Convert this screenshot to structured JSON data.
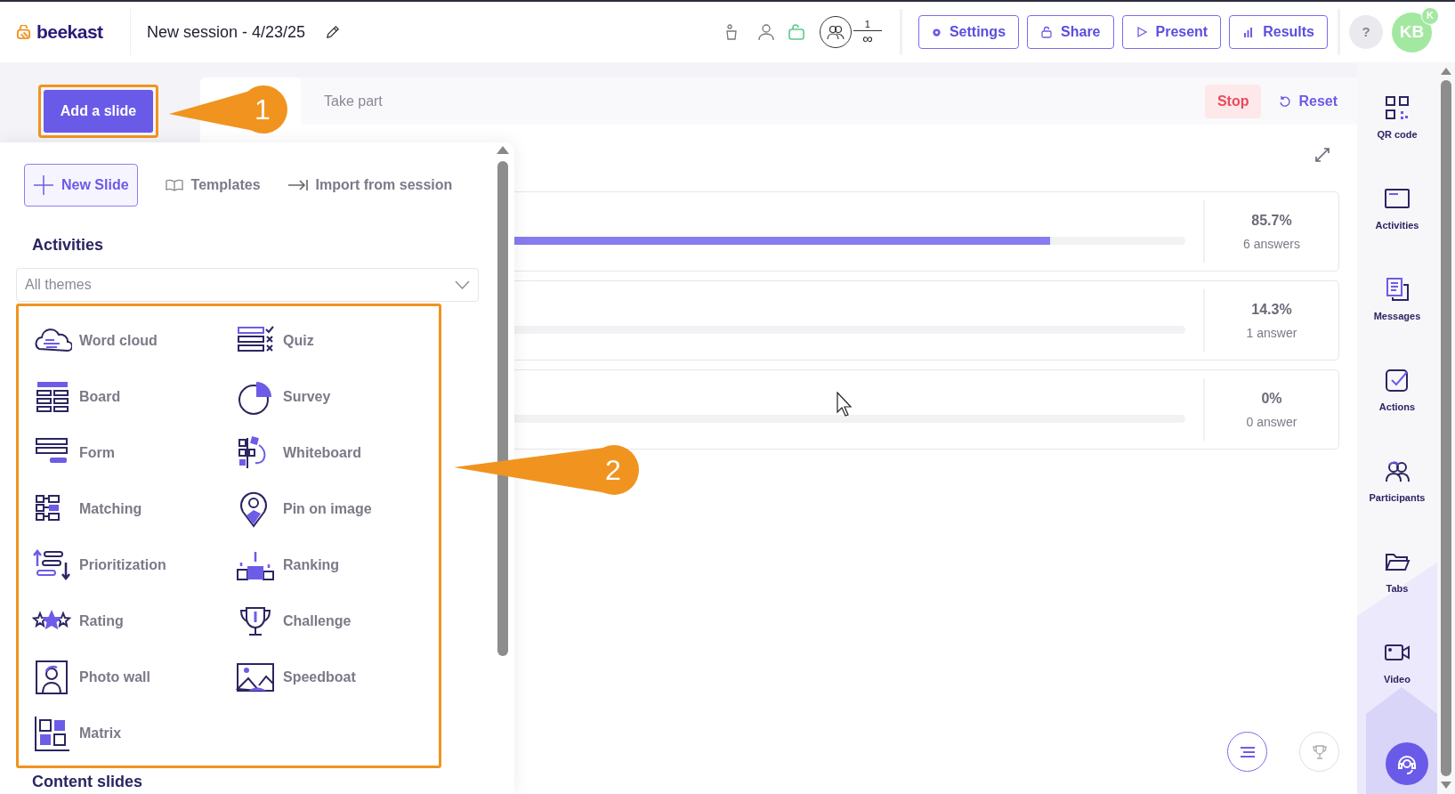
{
  "header": {
    "logo": "beekast",
    "title": "New session - 4/23/25",
    "participants": {
      "count": "1",
      "limit": "∞"
    },
    "buttons": [
      {
        "label": "Settings",
        "kind": "settings"
      },
      {
        "label": "Share",
        "kind": "share"
      },
      {
        "label": "Present",
        "kind": "present"
      },
      {
        "label": "Results",
        "kind": "results"
      }
    ],
    "help": "?",
    "avatar": {
      "initials": "KB",
      "badge": "K"
    }
  },
  "toolbar": {
    "add_button": "Add a slide",
    "tab": "Take part",
    "stop": "Stop",
    "reset": "Reset"
  },
  "callouts": [
    {
      "number": "1"
    },
    {
      "number": "2"
    }
  ],
  "results": [
    {
      "percent": "85.7%",
      "answers": "6 answers",
      "level": 0.857
    },
    {
      "percent": "14.3%",
      "answers": "1 answer"
    },
    {
      "percent": "0%",
      "answers": "0 answer"
    }
  ],
  "panel": {
    "tabs": [
      {
        "label": "New Slide",
        "selected": true
      },
      {
        "label": "Templates",
        "selected": false
      },
      {
        "label": "Import from session",
        "selected": false
      }
    ],
    "heading": "Activities",
    "theme_select": {
      "value": "All themes"
    },
    "activities": [
      {
        "label": "Word cloud"
      },
      {
        "label": "Quiz"
      },
      {
        "label": "Board"
      },
      {
        "label": "Survey"
      },
      {
        "label": "Form"
      },
      {
        "label": "Whiteboard"
      },
      {
        "label": "Matching"
      },
      {
        "label": "Pin on image"
      },
      {
        "label": "Prioritization"
      },
      {
        "label": "Ranking"
      },
      {
        "label": "Rating"
      },
      {
        "label": "Challenge"
      },
      {
        "label": "Photo wall"
      },
      {
        "label": "Speedboat"
      },
      {
        "label": "Matrix"
      }
    ],
    "next_heading": "Content slides"
  },
  "sidebar": {
    "items": [
      {
        "label": "QR code"
      },
      {
        "label": "Activities"
      },
      {
        "label": "Messages"
      },
      {
        "label": "Actions"
      },
      {
        "label": "Participants"
      },
      {
        "label": "Tabs"
      },
      {
        "label": "Video"
      }
    ]
  }
}
